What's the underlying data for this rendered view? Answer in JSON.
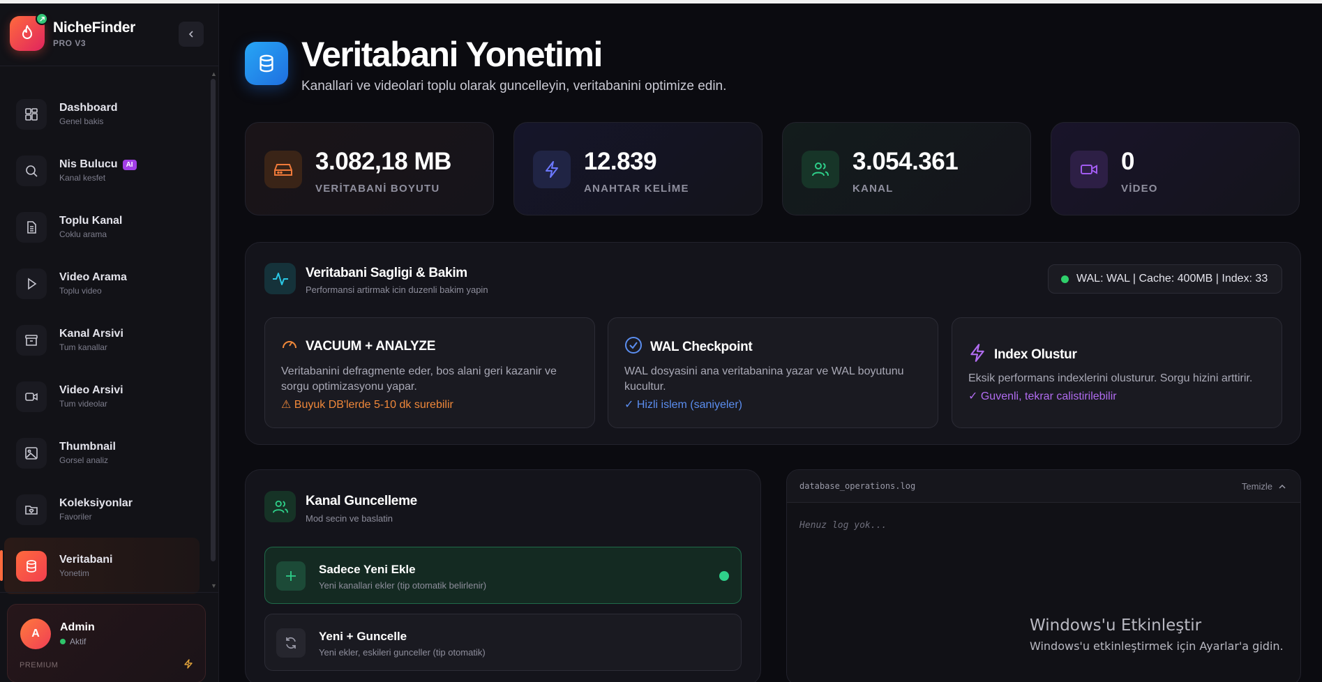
{
  "brand": {
    "name": "NicheFinder",
    "subtitle": "PRO V3"
  },
  "sidebar": {
    "items": [
      {
        "label": "Dashboard",
        "sub": "Genel bakis",
        "icon": "dashboard-grid-icon"
      },
      {
        "label": "Nis Bulucu",
        "sub": "Kanal kesfet",
        "icon": "search-icon",
        "badge": "AI"
      },
      {
        "label": "Toplu Kanal",
        "sub": "Coklu arama",
        "icon": "document-list-icon"
      },
      {
        "label": "Video Arama",
        "sub": "Toplu video",
        "icon": "play-icon"
      },
      {
        "label": "Kanal Arsivi",
        "sub": "Tum kanallar",
        "icon": "archive-icon"
      },
      {
        "label": "Video Arsivi",
        "sub": "Tum videolar",
        "icon": "video-camera-icon"
      },
      {
        "label": "Thumbnail",
        "sub": "Gorsel analiz",
        "icon": "image-icon"
      },
      {
        "label": "Koleksiyonlar",
        "sub": "Favoriler",
        "icon": "folder-heart-icon"
      },
      {
        "label": "Veritabani",
        "sub": "Yonetim",
        "icon": "database-icon",
        "active": true
      }
    ]
  },
  "user": {
    "initial": "A",
    "name": "Admin",
    "status": "Aktif",
    "tier": "PREMIUM"
  },
  "header": {
    "title": "Veritabani Yonetimi",
    "subtitle": "Kanallari ve videolari toplu olarak guncelleyin, veritabanini optimize edin."
  },
  "stats": [
    {
      "value": "3.082,18 MB",
      "label": "VERİTABANİ BOYUTU",
      "icon": "hard-drive-icon",
      "color": "#f07a3a"
    },
    {
      "value": "12.839",
      "label": "ANAHTAR KELİME",
      "icon": "lightning-icon",
      "color": "#6b78ff"
    },
    {
      "value": "3.054.361",
      "label": "KANAL",
      "icon": "users-icon",
      "color": "#2fd08a"
    },
    {
      "value": "0",
      "label": "VİDEO",
      "icon": "video-camera-icon",
      "color": "#a25cf0"
    }
  ],
  "health": {
    "title": "Veritabani Sagligi & Bakim",
    "subtitle": "Performansi artirmak icin duzenli bakim yapin",
    "status": "WAL: WAL | Cache: 400MB | Index: 33",
    "operations": [
      {
        "title": "VACUUM + ANALYZE",
        "desc": "Veritabanini defragmente eder, bos alani geri kazanir ve sorgu optimizasyonu yapar.",
        "note": "⚠ Buyuk DB'lerde 5-10 dk surebilir",
        "note_color": "#f0883a",
        "icon": "gauge-icon"
      },
      {
        "title": "WAL Checkpoint",
        "desc": "WAL dosyasini ana veritabanina yazar ve WAL boyutunu kucultur.",
        "note": "✓ Hizli islem (saniyeler)",
        "note_color": "#5b8ef0",
        "icon": "check-circle-icon"
      },
      {
        "title": "Index Olustur",
        "desc": "Eksik performans indexlerini olusturur. Sorgu hizini arttirir.",
        "note": "✓ Guvenli, tekrar calistirilebilir",
        "note_color": "#b16cf0",
        "icon": "lightning-icon"
      }
    ]
  },
  "channel_update": {
    "title": "Kanal Guncelleme",
    "subtitle": "Mod secin ve baslatin",
    "modes": [
      {
        "title": "Sadece Yeni Ekle",
        "sub": "Yeni kanallari ekler (tip otomatik belirlenir)",
        "icon": "plus-icon",
        "active": true
      },
      {
        "title": "Yeni + Guncelle",
        "sub": "Yeni ekler, eskileri gunceller (tip otomatik)",
        "icon": "refresh-icon",
        "active": false
      }
    ]
  },
  "log": {
    "filename": "database_operations.log",
    "clear_label": "Temizle",
    "empty_text": "Henuz log yok..."
  },
  "watermark": {
    "title": "Windows'u Etkinleştir",
    "subtitle": "Windows'u etkinleştirmek için Ayarlar'a gidin."
  }
}
